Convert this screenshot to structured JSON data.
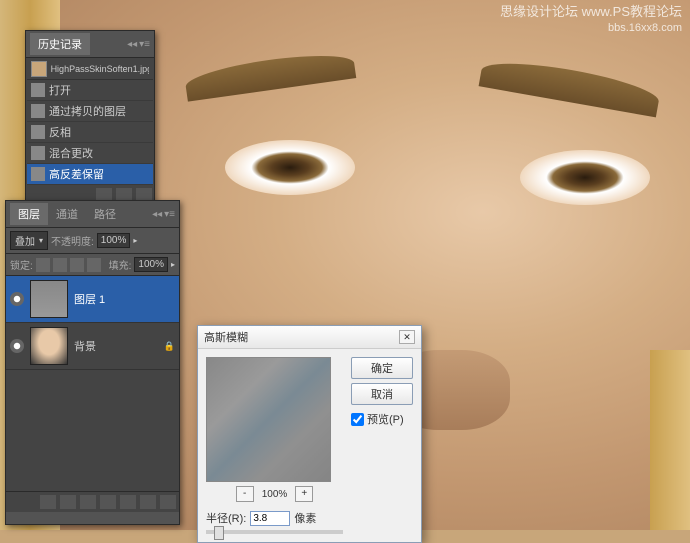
{
  "watermark": {
    "line1": "思缘设计论坛   www.PS教程论坛",
    "line2": "bbs.16xx8.com"
  },
  "history": {
    "tab": "历史记录",
    "filename": "HighPassSkinSoften1.jpg",
    "items": [
      {
        "label": "打开",
        "selected": false
      },
      {
        "label": "通过拷贝的图层",
        "selected": false
      },
      {
        "label": "反相",
        "selected": false
      },
      {
        "label": "混合更改",
        "selected": false
      },
      {
        "label": "高反差保留",
        "selected": true
      }
    ]
  },
  "layers": {
    "tabs": {
      "layers": "图层",
      "channels": "通道",
      "paths": "路径"
    },
    "blend_mode": "叠加",
    "opacity_label": "不透明度:",
    "opacity_value": "100%",
    "lock_label": "锁定:",
    "fill_label": "填充:",
    "fill_value": "100%",
    "items": [
      {
        "name": "图层 1",
        "selected": true
      },
      {
        "name": "背景",
        "selected": false
      }
    ]
  },
  "dialog": {
    "title": "高斯模糊",
    "ok": "确定",
    "cancel": "取消",
    "preview_label": "预览(P)",
    "zoom": "100%",
    "radius_label": "半径(R):",
    "radius_value": "3.8",
    "radius_unit": "像素"
  }
}
